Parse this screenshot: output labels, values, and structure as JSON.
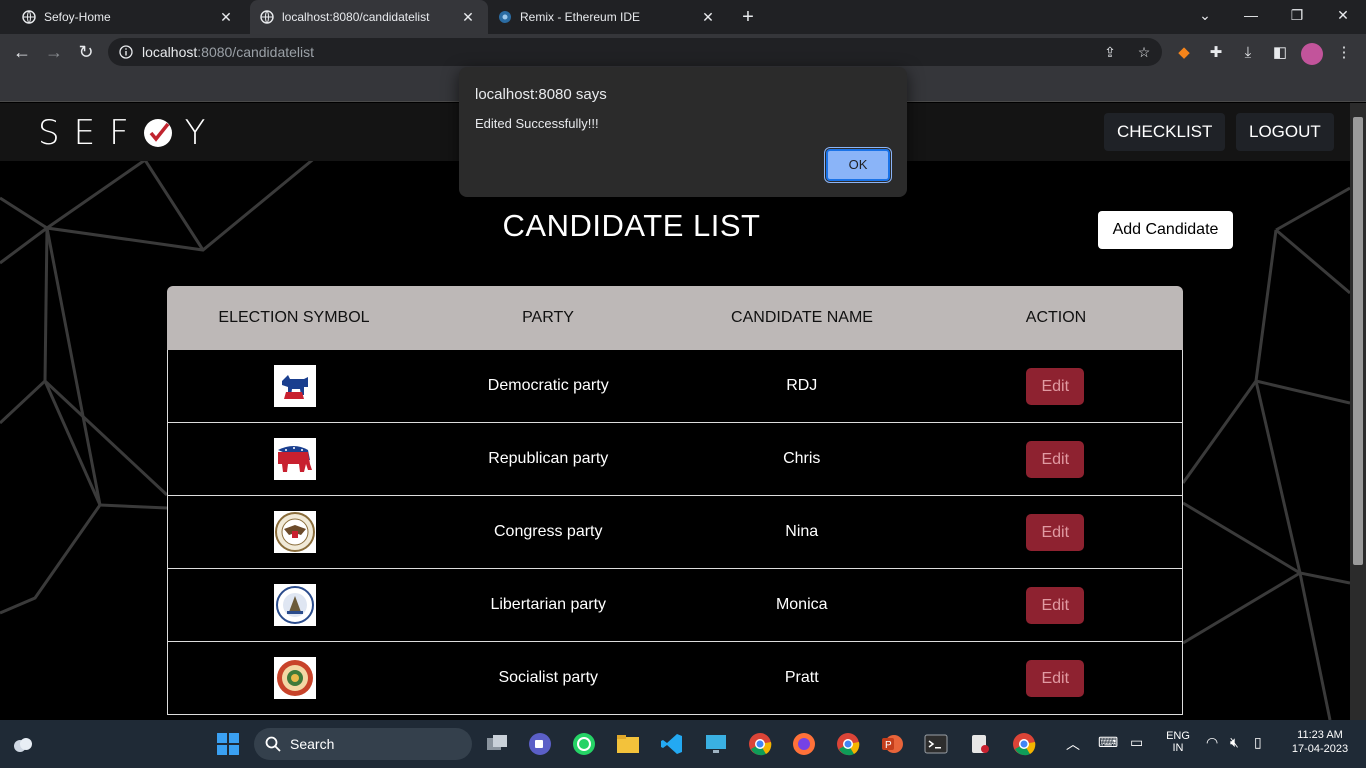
{
  "browser": {
    "tabs": [
      {
        "title": "Sefoy-Home",
        "active": false
      },
      {
        "title": "localhost:8080/candidatelist",
        "active": true
      },
      {
        "title": "Remix - Ethereum IDE",
        "active": false
      }
    ],
    "url_host": "localhost",
    "url_rest": ":8080/candidatelist"
  },
  "nav": {
    "logo_text": "SEF",
    "logo_text_end": "Y",
    "links": [
      "CHECKLIST",
      "LOGOUT"
    ]
  },
  "page": {
    "heading": "CANDIDATE LIST",
    "add_button": "Add Candidate"
  },
  "table": {
    "headers": [
      "ELECTION SYMBOL",
      "PARTY",
      "CANDIDATE NAME",
      "ACTION"
    ],
    "rows": [
      {
        "symbol": "donkey-icon",
        "party": "Democratic party",
        "name": "RDJ",
        "action": "Edit"
      },
      {
        "symbol": "elephant-icon",
        "party": "Republican party",
        "name": "Chris",
        "action": "Edit"
      },
      {
        "symbol": "eagle-seal-icon",
        "party": "Congress party",
        "name": "Nina",
        "action": "Edit"
      },
      {
        "symbol": "seal-icon",
        "party": "Libertarian party",
        "name": "Monica",
        "action": "Edit"
      },
      {
        "symbol": "round-seal-icon",
        "party": "Socialist party",
        "name": "Pratt",
        "action": "Edit"
      }
    ]
  },
  "dialog": {
    "title": "localhost:8080 says",
    "message": "Edited Successfully!!!",
    "ok": "OK"
  },
  "taskbar": {
    "search": "Search",
    "lang_top": "ENG",
    "lang_bottom": "IN",
    "time": "11:23 AM",
    "date": "17-04-2023"
  },
  "colors": {
    "edit_button": "#8e2230",
    "table_header": "#bdb8b7",
    "dialog_ok": "#8ab4f8"
  }
}
